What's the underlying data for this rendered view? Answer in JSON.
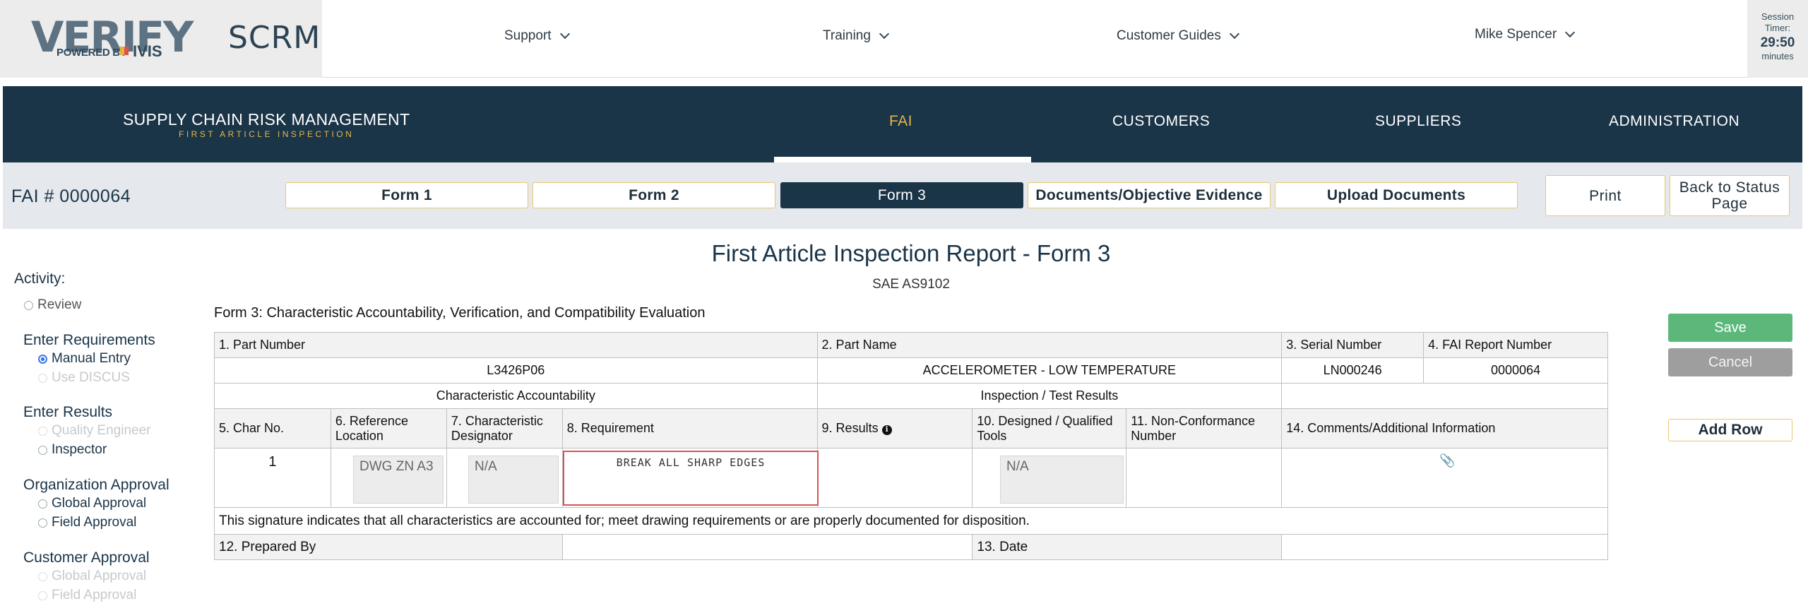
{
  "header": {
    "logo_text": "VERIFY",
    "logo_powered": "POWERED BY",
    "logo_ivis": "IVIS",
    "app_name": "SCRM",
    "nav": [
      {
        "label": "Support"
      },
      {
        "label": "Training"
      },
      {
        "label": "Customer Guides"
      },
      {
        "label": "Mike Spencer"
      }
    ],
    "session": {
      "label_1": "Session",
      "label_2": "Timer:",
      "time": "29:50",
      "unit": "minutes"
    }
  },
  "navbar": {
    "brand_title": "SUPPLY CHAIN RISK MANAGEMENT",
    "brand_sub": "FIRST ARTICLE INSPECTION",
    "tabs": [
      {
        "label": "FAI",
        "active": true
      },
      {
        "label": "CUSTOMERS"
      },
      {
        "label": "SUPPLIERS"
      },
      {
        "label": "ADMINISTRATION"
      }
    ]
  },
  "subbar": {
    "fai_number": "FAI # 0000064",
    "form_tabs": [
      {
        "label": "Form 1"
      },
      {
        "label": "Form 2"
      },
      {
        "label": "Form 3",
        "active": true
      },
      {
        "label": "Documents/Objective Evidence"
      },
      {
        "label": "Upload Documents"
      }
    ],
    "print_label": "Print",
    "back_label_1": "Back to Status",
    "back_label_2": "Page"
  },
  "sidebar": {
    "activity": "Activity:",
    "review": "Review",
    "enter_requirements": "Enter Requirements",
    "manual_entry": "Manual Entry",
    "use_discus": "Use DISCUS",
    "enter_results": "Enter Results",
    "quality_engineer": "Quality Engineer",
    "inspector": "Inspector",
    "org_approval": "Organization Approval",
    "org_global": "Global Approval",
    "org_field": "Field Approval",
    "customer_approval": "Customer Approval",
    "cust_global": "Global Approval",
    "cust_field": "Field Approval"
  },
  "main": {
    "title": "First Article Inspection Report - Form 3",
    "subtitle": "SAE AS9102",
    "form_label": "Form 3: Characteristic Accountability, Verification, and Compatibility Evaluation",
    "part_number_label": "1. Part Number",
    "part_name_label": "2. Part Name",
    "serial_label": "3. Serial Number",
    "fai_report_label": "4. FAI Report Number",
    "part_number": "L3426P06",
    "part_name": "ACCELEROMETER - LOW TEMPERATURE",
    "serial_number": "LN000246",
    "fai_report_number": "0000064",
    "group_char": "Characteristic Accountability",
    "group_insp": "Inspection / Test Results",
    "col_char_no": "5. Char No.",
    "col_ref_loc": "6. Reference Location",
    "col_char_des": "7. Characteristic Designator",
    "col_req": "8. Requirement",
    "col_results": "9. Results",
    "col_tools": "10. Designed / Qualified Tools",
    "col_ncr": "11. Non-Conformance Number",
    "col_comments": "14. Comments/Additional Information",
    "row": {
      "char_no": "1",
      "ref_loc": "DWG ZN A3",
      "char_des": "N/A",
      "requirement": "BREAK ALL SHARP EDGES",
      "tools": "N/A"
    },
    "signature_text": "This signature indicates that all characteristics are accounted for; meet drawing requirements or are properly documented for disposition.",
    "prepared_by": "12. Prepared By",
    "date": "13. Date"
  },
  "actions": {
    "save": "Save",
    "cancel": "Cancel",
    "add_row": "Add Row"
  }
}
